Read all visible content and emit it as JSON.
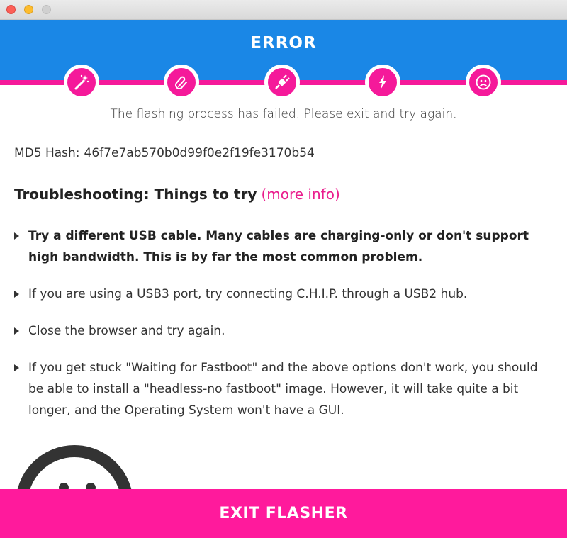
{
  "header": {
    "title": "ERROR"
  },
  "steps": [
    {
      "icon": "magic-wand-icon"
    },
    {
      "icon": "paperclip-icon"
    },
    {
      "icon": "plug-icon"
    },
    {
      "icon": "lightning-icon"
    },
    {
      "icon": "sad-face-icon"
    }
  ],
  "status_message": "The flashing process has failed. Please exit and try again.",
  "md5": {
    "label": "MD5 Hash:",
    "value": "46f7e7ab570b0d99f0e2f19fe3170b54"
  },
  "troubleshooting": {
    "heading": "Troubleshooting: Things to try",
    "link": "(more info)"
  },
  "tips": [
    "Try a different USB cable. Many cables are charging-only or don't support high bandwidth. This is by far the most common problem.",
    "If you are using a USB3 port, try connecting C.H.I.P. through a USB2 hub.",
    "Close the browser and try again.",
    "If you get stuck \"Waiting for Fastboot\" and the above options don't work, you should be able to install a \"headless-no fastboot\" image. However, it will take quite a bit longer, and the Operating System won't have a GUI."
  ],
  "exit_button": "EXIT FLASHER",
  "colors": {
    "header_blue": "#1a87e6",
    "accent_pink": "#f5199a",
    "exit_pink": "#ff1a9c"
  }
}
